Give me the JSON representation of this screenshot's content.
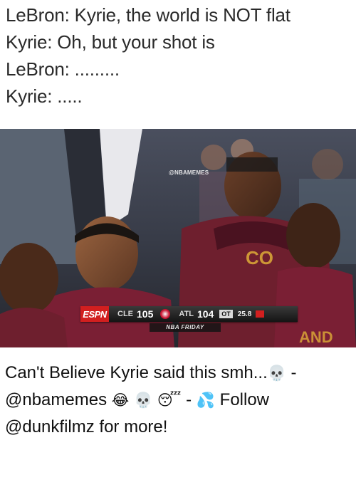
{
  "caption_lines": [
    "LeBron: Kyrie, the world is NOT flat",
    "Kyrie: Oh, but your shot is",
    "LeBron: .........",
    "Kyrie: ....."
  ],
  "photo": {
    "watermark": "@NBAMEMES",
    "scoreboard": {
      "network": "ESPN",
      "team1": "CLE",
      "score1": "105",
      "team2": "ATL",
      "score2": "104",
      "period": "OT",
      "clock": "25.8",
      "program": "NBA FRIDAY",
      "colors": {
        "network_red": "#d21f1f",
        "cle_wine": "#7a1f34",
        "atl_red": "#c8102e"
      }
    }
  },
  "post_caption": {
    "part1": "Can't Believe Kyrie said this smh...",
    "emoji_skull_1": "💀",
    "part2": " - @nbamemes ",
    "emoji_joy": "😂",
    "emoji_skull_2": "💀",
    "emoji_sleep": "😴",
    "part3": " - ",
    "emoji_sweat": "💦",
    "part4": " Follow @dunkfilmz for more!"
  }
}
